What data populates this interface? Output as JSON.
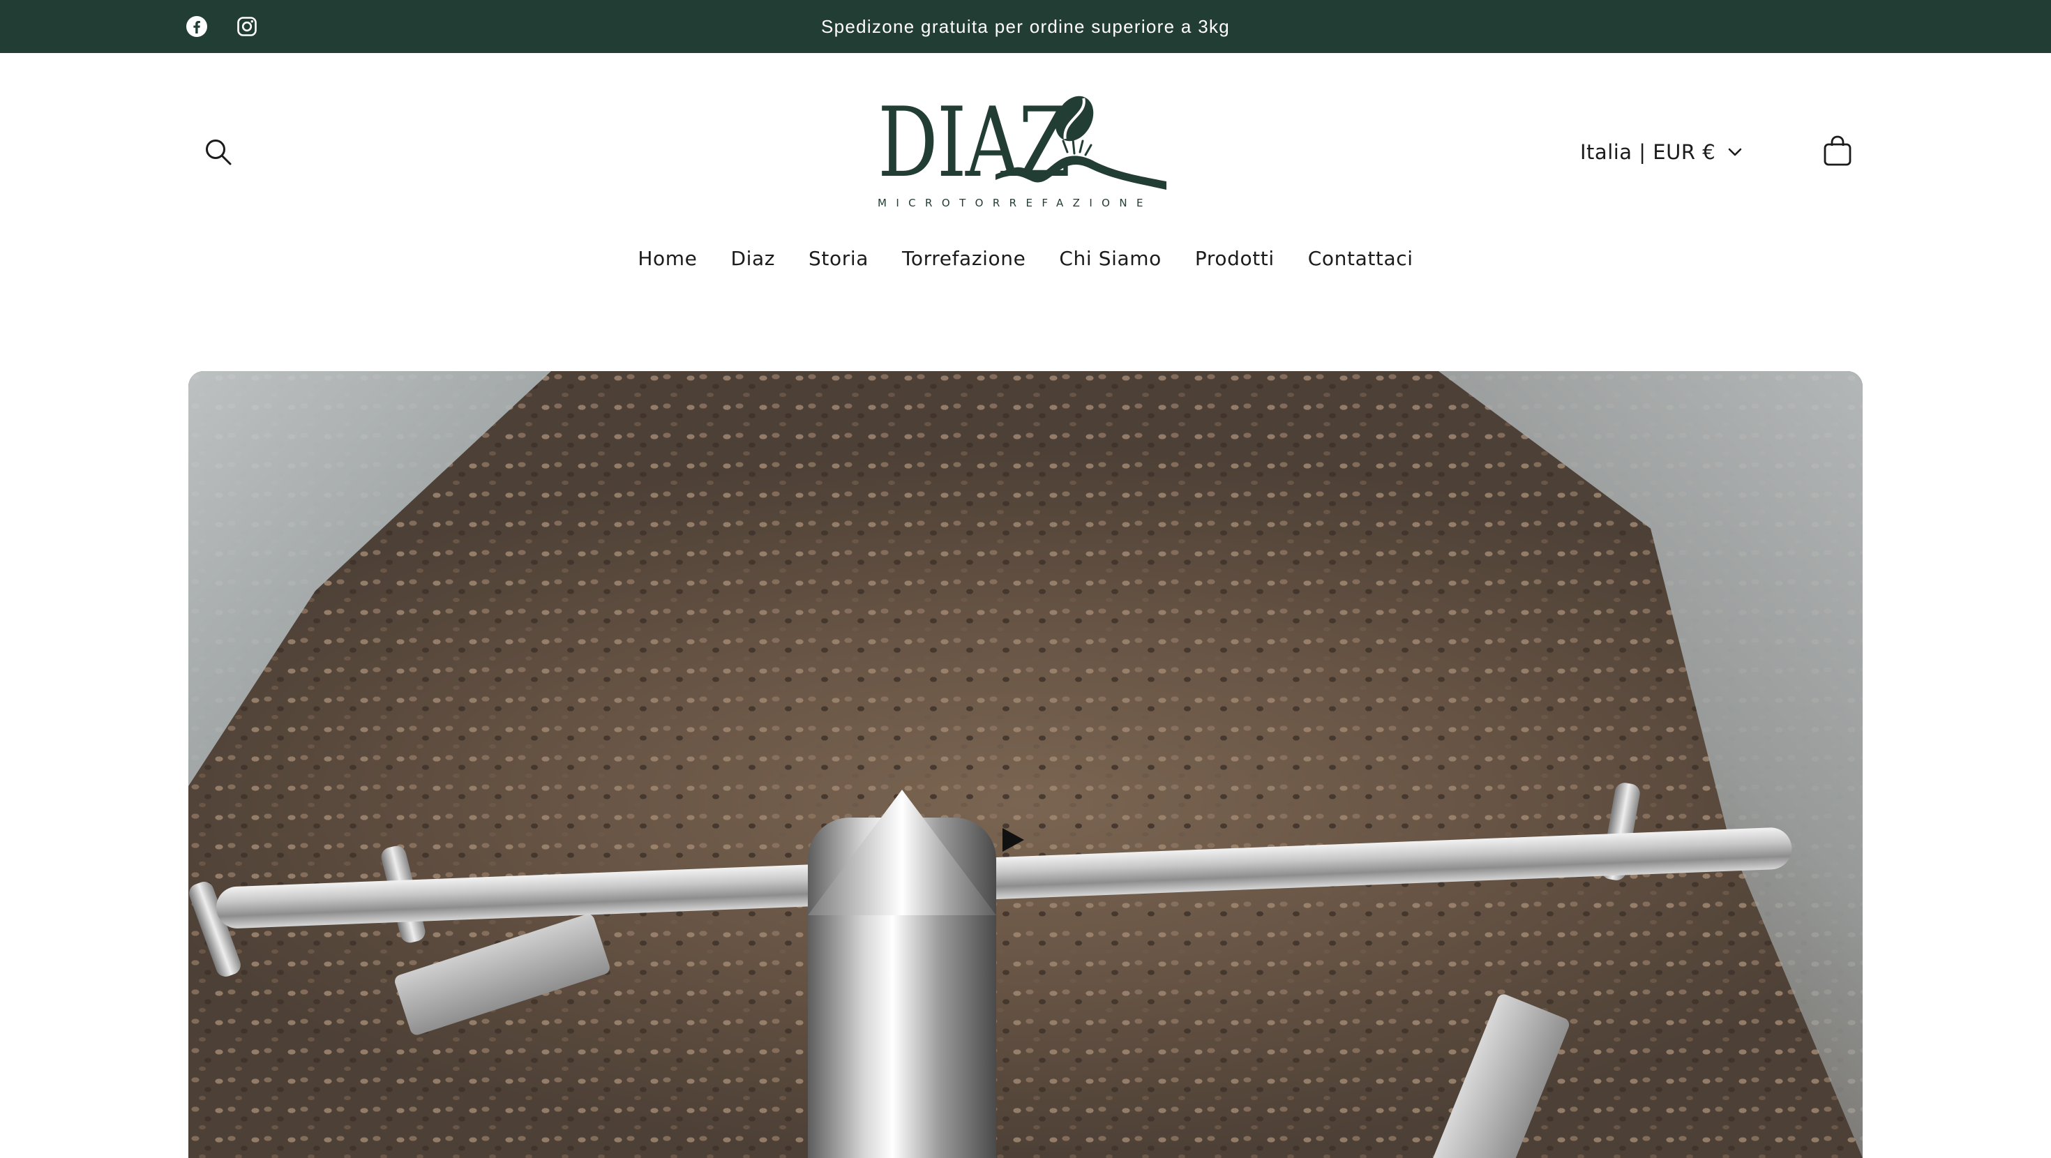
{
  "announcement": {
    "text": "Spedizone gratuita per ordine superiore a 3kg"
  },
  "social": [
    {
      "name": "facebook-icon"
    },
    {
      "name": "instagram-icon"
    }
  ],
  "brand": {
    "name": "DIAZ",
    "tagline": "MICROTORREFAZIONE"
  },
  "header": {
    "locale_label": "Italia | EUR €"
  },
  "nav": [
    {
      "label": "Home"
    },
    {
      "label": "Diaz"
    },
    {
      "label": "Storia"
    },
    {
      "label": "Torrefazione"
    },
    {
      "label": "Chi Siamo"
    },
    {
      "label": "Prodotti"
    },
    {
      "label": "Contattaci"
    }
  ],
  "hero": {
    "media": "video",
    "control_icon": "play-icon"
  },
  "colors": {
    "brand_green": "#223d33",
    "text": "#1b1b1b",
    "background": "#ffffff"
  }
}
